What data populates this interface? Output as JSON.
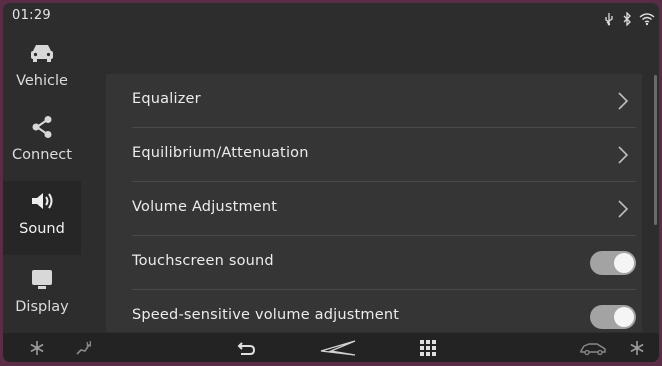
{
  "status": {
    "time": "01:29"
  },
  "sidebar": {
    "items": [
      {
        "label": "Vehicle"
      },
      {
        "label": "Connect"
      },
      {
        "label": "Sound"
      },
      {
        "label": "Display"
      }
    ],
    "active": "Sound"
  },
  "main": {
    "rows": [
      {
        "label": "Equalizer",
        "control": "chevron"
      },
      {
        "label": "Equilibrium/Attenuation",
        "control": "chevron"
      },
      {
        "label": "Volume Adjustment",
        "control": "chevron"
      },
      {
        "label": "Touchscreen sound",
        "control": "toggle",
        "on": true
      },
      {
        "label": "Speed-sensitive volume adjustment",
        "control": "toggle",
        "on": true
      }
    ]
  },
  "bottom_bar": {
    "icons": [
      "fan-icon",
      "seat-heat-icon",
      "back-icon",
      "brand-logo-icon",
      "apps-grid-icon",
      "car-icon",
      "fan-icon"
    ]
  },
  "colors": {
    "background": "#2d2d2d",
    "panel": "#353535",
    "toggle_track": "#a3a3a3",
    "frame": "#5a2c46"
  }
}
